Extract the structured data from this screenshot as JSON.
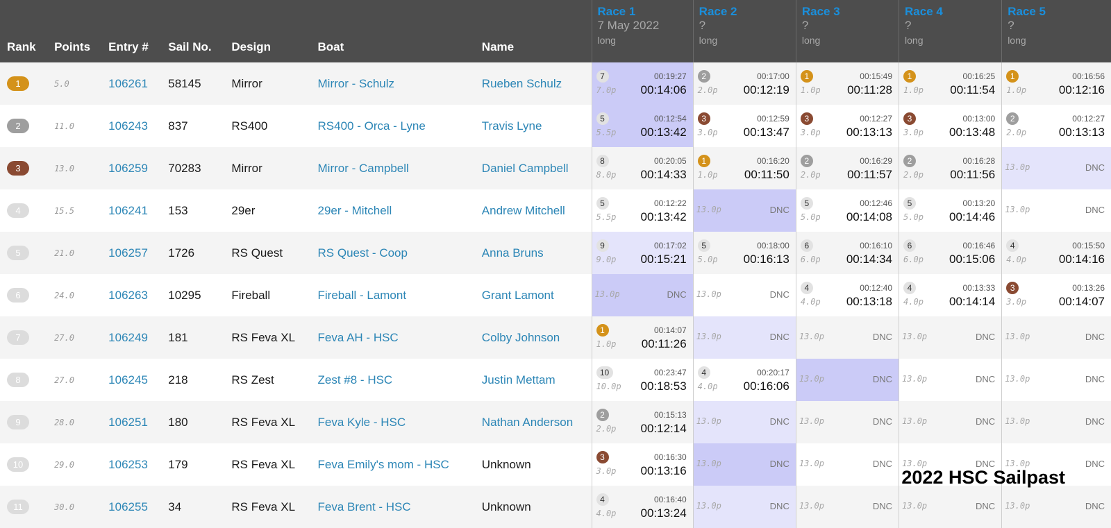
{
  "colors": {
    "header_bg": "#4d4d4d",
    "link": "#2c86b6",
    "race_title": "#1a8fdc",
    "rank_gold": "#d4921a",
    "rank_silver": "#9e9e9e",
    "rank_bronze": "#8a4a32",
    "rank_other": "#dcdcdc",
    "discard_light": "#e4e4fb",
    "discard_dark": "#cbcbf7"
  },
  "headers": {
    "rank": "Rank",
    "points": "Points",
    "entry": "Entry #",
    "sail": "Sail No.",
    "design": "Design",
    "boat": "Boat",
    "name": "Name"
  },
  "races": [
    {
      "title": "Race 1",
      "date": "7 May 2022",
      "kind": "long"
    },
    {
      "title": "Race 2",
      "date": "?",
      "kind": "long"
    },
    {
      "title": "Race 3",
      "date": "?",
      "kind": "long"
    },
    {
      "title": "Race 4",
      "date": "?",
      "kind": "long"
    },
    {
      "title": "Race 5",
      "date": "?",
      "kind": "long"
    }
  ],
  "rows": [
    {
      "rank": "1",
      "medal": "gold",
      "points": "5.0",
      "entry": "106261",
      "sail": "58145",
      "design": "Mirror",
      "boat": "Mirror - Schulz",
      "name": "Rueben Schulz",
      "name_link": true,
      "results": [
        {
          "pos": "7",
          "badge": "other",
          "elapsed": "00:19:27",
          "corrected": "00:14:06",
          "pts": "7.0p",
          "hl": "dark"
        },
        {
          "pos": "2",
          "badge": "silver",
          "elapsed": "00:17:00",
          "corrected": "00:12:19",
          "pts": "2.0p",
          "hl": ""
        },
        {
          "pos": "1",
          "badge": "gold",
          "elapsed": "00:15:49",
          "corrected": "00:11:28",
          "pts": "1.0p",
          "hl": ""
        },
        {
          "pos": "1",
          "badge": "gold",
          "elapsed": "00:16:25",
          "corrected": "00:11:54",
          "pts": "1.0p",
          "hl": ""
        },
        {
          "pos": "1",
          "badge": "gold",
          "elapsed": "00:16:56",
          "corrected": "00:12:16",
          "pts": "1.0p",
          "hl": ""
        }
      ]
    },
    {
      "rank": "2",
      "medal": "silver",
      "points": "11.0",
      "entry": "106243",
      "sail": "837",
      "design": "RS400",
      "boat": "RS400 - Orca - Lyne",
      "name": "Travis Lyne",
      "name_link": true,
      "results": [
        {
          "pos": "5",
          "badge": "other",
          "elapsed": "00:12:54",
          "corrected": "00:13:42",
          "pts": "5.5p",
          "hl": "dark"
        },
        {
          "pos": "3",
          "badge": "bronze",
          "elapsed": "00:12:59",
          "corrected": "00:13:47",
          "pts": "3.0p",
          "hl": ""
        },
        {
          "pos": "3",
          "badge": "bronze",
          "elapsed": "00:12:27",
          "corrected": "00:13:13",
          "pts": "3.0p",
          "hl": ""
        },
        {
          "pos": "3",
          "badge": "bronze",
          "elapsed": "00:13:00",
          "corrected": "00:13:48",
          "pts": "3.0p",
          "hl": ""
        },
        {
          "pos": "2",
          "badge": "silver",
          "elapsed": "00:12:27",
          "corrected": "00:13:13",
          "pts": "2.0p",
          "hl": ""
        }
      ]
    },
    {
      "rank": "3",
      "medal": "bronze",
      "points": "13.0",
      "entry": "106259",
      "sail": "70283",
      "design": "Mirror",
      "boat": "Mirror - Campbell",
      "name": "Daniel Campbell",
      "name_link": true,
      "results": [
        {
          "pos": "8",
          "badge": "other",
          "elapsed": "00:20:05",
          "corrected": "00:14:33",
          "pts": "8.0p",
          "hl": ""
        },
        {
          "pos": "1",
          "badge": "gold",
          "elapsed": "00:16:20",
          "corrected": "00:11:50",
          "pts": "1.0p",
          "hl": ""
        },
        {
          "pos": "2",
          "badge": "silver",
          "elapsed": "00:16:29",
          "corrected": "00:11:57",
          "pts": "2.0p",
          "hl": ""
        },
        {
          "pos": "2",
          "badge": "silver",
          "elapsed": "00:16:28",
          "corrected": "00:11:56",
          "pts": "2.0p",
          "hl": ""
        },
        {
          "dnc": true,
          "pts": "13.0p",
          "label": "DNC",
          "hl": "light"
        }
      ]
    },
    {
      "rank": "4",
      "medal": "other",
      "points": "15.5",
      "entry": "106241",
      "sail": "153",
      "design": "29er",
      "boat": "29er - Mitchell",
      "name": "Andrew Mitchell",
      "name_link": true,
      "results": [
        {
          "pos": "5",
          "badge": "other",
          "elapsed": "00:12:22",
          "corrected": "00:13:42",
          "pts": "5.5p",
          "hl": ""
        },
        {
          "dnc": true,
          "pts": "13.0p",
          "label": "DNC",
          "hl": "dark"
        },
        {
          "pos": "5",
          "badge": "other",
          "elapsed": "00:12:46",
          "corrected": "00:14:08",
          "pts": "5.0p",
          "hl": ""
        },
        {
          "pos": "5",
          "badge": "other",
          "elapsed": "00:13:20",
          "corrected": "00:14:46",
          "pts": "5.0p",
          "hl": ""
        },
        {
          "dnc": true,
          "pts": "13.0p",
          "label": "DNC",
          "hl": ""
        }
      ]
    },
    {
      "rank": "5",
      "medal": "other",
      "points": "21.0",
      "entry": "106257",
      "sail": "1726",
      "design": "RS Quest",
      "boat": "RS Quest - Coop",
      "name": "Anna Bruns",
      "name_link": true,
      "results": [
        {
          "pos": "9",
          "badge": "other",
          "elapsed": "00:17:02",
          "corrected": "00:15:21",
          "pts": "9.0p",
          "hl": "light"
        },
        {
          "pos": "5",
          "badge": "other",
          "elapsed": "00:18:00",
          "corrected": "00:16:13",
          "pts": "5.0p",
          "hl": ""
        },
        {
          "pos": "6",
          "badge": "other",
          "elapsed": "00:16:10",
          "corrected": "00:14:34",
          "pts": "6.0p",
          "hl": ""
        },
        {
          "pos": "6",
          "badge": "other",
          "elapsed": "00:16:46",
          "corrected": "00:15:06",
          "pts": "6.0p",
          "hl": ""
        },
        {
          "pos": "4",
          "badge": "other",
          "elapsed": "00:15:50",
          "corrected": "00:14:16",
          "pts": "4.0p",
          "hl": ""
        }
      ]
    },
    {
      "rank": "6",
      "medal": "other",
      "points": "24.0",
      "entry": "106263",
      "sail": "10295",
      "design": "Fireball",
      "boat": "Fireball - Lamont",
      "name": "Grant Lamont",
      "name_link": true,
      "results": [
        {
          "dnc": true,
          "pts": "13.0p",
          "label": "DNC",
          "hl": "dark"
        },
        {
          "dnc": true,
          "pts": "13.0p",
          "label": "DNC",
          "hl": ""
        },
        {
          "pos": "4",
          "badge": "other",
          "elapsed": "00:12:40",
          "corrected": "00:13:18",
          "pts": "4.0p",
          "hl": ""
        },
        {
          "pos": "4",
          "badge": "other",
          "elapsed": "00:13:33",
          "corrected": "00:14:14",
          "pts": "4.0p",
          "hl": ""
        },
        {
          "pos": "3",
          "badge": "bronze",
          "elapsed": "00:13:26",
          "corrected": "00:14:07",
          "pts": "3.0p",
          "hl": ""
        }
      ]
    },
    {
      "rank": "7",
      "medal": "other",
      "points": "27.0",
      "entry": "106249",
      "sail": "181",
      "design": "RS Feva XL",
      "boat": "Feva AH - HSC",
      "name": "Colby Johnson",
      "name_link": true,
      "results": [
        {
          "pos": "1",
          "badge": "gold",
          "elapsed": "00:14:07",
          "corrected": "00:11:26",
          "pts": "1.0p",
          "hl": ""
        },
        {
          "dnc": true,
          "pts": "13.0p",
          "label": "DNC",
          "hl": "light"
        },
        {
          "dnc": true,
          "pts": "13.0p",
          "label": "DNC",
          "hl": ""
        },
        {
          "dnc": true,
          "pts": "13.0p",
          "label": "DNC",
          "hl": ""
        },
        {
          "dnc": true,
          "pts": "13.0p",
          "label": "DNC",
          "hl": ""
        }
      ]
    },
    {
      "rank": "8",
      "medal": "other",
      "points": "27.0",
      "entry": "106245",
      "sail": "218",
      "design": "RS Zest",
      "boat": "Zest #8 - HSC",
      "name": "Justin Mettam",
      "name_link": true,
      "results": [
        {
          "pos": "10",
          "badge": "other",
          "elapsed": "00:23:47",
          "corrected": "00:18:53",
          "pts": "10.0p",
          "hl": ""
        },
        {
          "pos": "4",
          "badge": "other",
          "elapsed": "00:20:17",
          "corrected": "00:16:06",
          "pts": "4.0p",
          "hl": ""
        },
        {
          "dnc": true,
          "pts": "13.0p",
          "label": "DNC",
          "hl": "dark"
        },
        {
          "dnc": true,
          "pts": "13.0p",
          "label": "DNC",
          "hl": ""
        },
        {
          "dnc": true,
          "pts": "13.0p",
          "label": "DNC",
          "hl": ""
        }
      ]
    },
    {
      "rank": "9",
      "medal": "other",
      "points": "28.0",
      "entry": "106251",
      "sail": "180",
      "design": "RS Feva XL",
      "boat": "Feva Kyle - HSC",
      "name": "Nathan Anderson",
      "name_link": true,
      "results": [
        {
          "pos": "2",
          "badge": "silver",
          "elapsed": "00:15:13",
          "corrected": "00:12:14",
          "pts": "2.0p",
          "hl": ""
        },
        {
          "dnc": true,
          "pts": "13.0p",
          "label": "DNC",
          "hl": "light"
        },
        {
          "dnc": true,
          "pts": "13.0p",
          "label": "DNC",
          "hl": ""
        },
        {
          "dnc": true,
          "pts": "13.0p",
          "label": "DNC",
          "hl": ""
        },
        {
          "dnc": true,
          "pts": "13.0p",
          "label": "DNC",
          "hl": ""
        }
      ]
    },
    {
      "rank": "10",
      "medal": "other",
      "points": "29.0",
      "entry": "106253",
      "sail": "179",
      "design": "RS Feva XL",
      "boat": "Feva Emily's mom - HSC",
      "name": "Unknown",
      "name_link": false,
      "results": [
        {
          "pos": "3",
          "badge": "bronze",
          "elapsed": "00:16:30",
          "corrected": "00:13:16",
          "pts": "3.0p",
          "hl": ""
        },
        {
          "dnc": true,
          "pts": "13.0p",
          "label": "DNC",
          "hl": "dark"
        },
        {
          "dnc": true,
          "pts": "13.0p",
          "label": "DNC",
          "hl": ""
        },
        {
          "dnc": true,
          "pts": "13.0p",
          "label": "DNC",
          "hl": ""
        },
        {
          "dnc": true,
          "pts": "13.0p",
          "label": "DNC",
          "hl": ""
        }
      ]
    },
    {
      "rank": "11",
      "medal": "other",
      "points": "30.0",
      "entry": "106255",
      "sail": "34",
      "design": "RS Feva XL",
      "boat": "Feva Brent - HSC",
      "name": "Unknown",
      "name_link": false,
      "results": [
        {
          "pos": "4",
          "badge": "other",
          "elapsed": "00:16:40",
          "corrected": "00:13:24",
          "pts": "4.0p",
          "hl": ""
        },
        {
          "dnc": true,
          "pts": "13.0p",
          "label": "DNC",
          "hl": "light"
        },
        {
          "dnc": true,
          "pts": "13.0p",
          "label": "DNC",
          "hl": ""
        },
        {
          "dnc": true,
          "pts": "13.0p",
          "label": "DNC",
          "hl": ""
        },
        {
          "dnc": true,
          "pts": "13.0p",
          "label": "DNC",
          "hl": ""
        }
      ]
    }
  ],
  "watermark": "2022 HSC Sailpast"
}
